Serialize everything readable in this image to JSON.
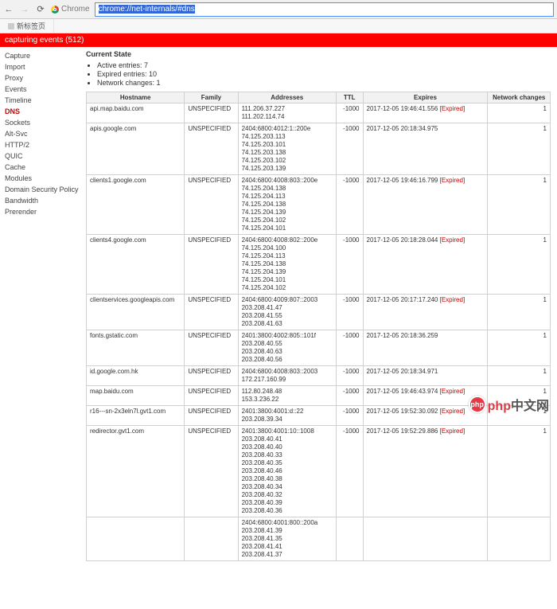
{
  "browser": {
    "back": "←",
    "forward": "→",
    "reload": "⟳",
    "label": "Chrome",
    "url": "chrome://net-internals/#dns"
  },
  "tab": {
    "title": "新标签页"
  },
  "banner": "capturing events (512)",
  "sidebar": [
    "Capture",
    "Import",
    "Proxy",
    "Events",
    "Timeline",
    "DNS",
    "Sockets",
    "Alt-Svc",
    "HTTP/2",
    "QUIC",
    "Cache",
    "Modules",
    "Domain Security Policy",
    "Bandwidth",
    "Prerender"
  ],
  "activeTab": "DNS",
  "section": "Current State",
  "stats": [
    "Active entries: 7",
    "Expired entries: 10",
    "Network changes: 1"
  ],
  "headers": {
    "host": "Hostname",
    "family": "Family",
    "addr": "Addresses",
    "ttl": "TTL",
    "exp": "Expires",
    "nc": "Network changes"
  },
  "expiredLabel": "[Expired]",
  "rows": [
    {
      "host": "api.map.baidu.com",
      "family": "UNSPECIFIED",
      "addr": [
        "111.206.37.227",
        "111.202.114.74"
      ],
      "ttl": "-1000",
      "exp": "2017-12-05 19:46:41.556",
      "expired": true,
      "nc": "1"
    },
    {
      "host": "apis.google.com",
      "family": "UNSPECIFIED",
      "addr": [
        "2404:6800:4012:1::200e",
        "74.125.203.113",
        "74.125.203.101",
        "74.125.203.138",
        "74.125.203.102",
        "74.125.203.139"
      ],
      "ttl": "-1000",
      "exp": "2017-12-05 20:18:34.975",
      "expired": false,
      "nc": "1"
    },
    {
      "host": "clients1.google.com",
      "family": "UNSPECIFIED",
      "addr": [
        "2404:6800:4008:803::200e",
        "74.125.204.138",
        "74.125.204.113",
        "74.125.204.138",
        "74.125.204.139",
        "74.125.204.102",
        "74.125.204.101"
      ],
      "ttl": "-1000",
      "exp": "2017-12-05 19:46:16.799",
      "expired": true,
      "nc": "1"
    },
    {
      "host": "clients4.google.com",
      "family": "UNSPECIFIED",
      "addr": [
        "2404:6800:4008:802::200e",
        "74.125.204.100",
        "74.125.204.113",
        "74.125.204.138",
        "74.125.204.139",
        "74.125.204.101",
        "74.125.204.102"
      ],
      "ttl": "-1000",
      "exp": "2017-12-05 20:18:28.044",
      "expired": true,
      "nc": "1"
    },
    {
      "host": "clientservices.googleapis.com",
      "family": "UNSPECIFIED",
      "addr": [
        "2404:6800:4009:807::2003",
        "203.208.41.47",
        "203.208.41.55",
        "203.208.41.63"
      ],
      "ttl": "-1000",
      "exp": "2017-12-05 20:17:17.240",
      "expired": true,
      "nc": "1"
    },
    {
      "host": "fonts.gstatic.com",
      "family": "UNSPECIFIED",
      "addr": [
        "2401:3800:4002:805::101f",
        "203.208.40.55",
        "203.208.40.63",
        "203.208.40.56"
      ],
      "ttl": "-1000",
      "exp": "2017-12-05 20:18:36.259",
      "expired": false,
      "nc": "1"
    },
    {
      "host": "id.google.com.hk",
      "family": "UNSPECIFIED",
      "addr": [
        "2404:6800:4008:803::2003",
        "172.217.160.99"
      ],
      "ttl": "-1000",
      "exp": "2017-12-05 20:18:34.971",
      "expired": false,
      "nc": "1"
    },
    {
      "host": "map.baidu.com",
      "family": "UNSPECIFIED",
      "addr": [
        "112.80.248.48",
        "153.3.236.22"
      ],
      "ttl": "-1000",
      "exp": "2017-12-05 19:46:43.974",
      "expired": true,
      "nc": "1"
    },
    {
      "host": "r16---sn-2x3eln7l.gvt1.com",
      "family": "UNSPECIFIED",
      "addr": [
        "2401:3800:4001:d::22",
        "203.208.39.34"
      ],
      "ttl": "-1000",
      "exp": "2017-12-05 19:52:30.092",
      "expired": true,
      "nc": "1"
    },
    {
      "host": "redirector.gvt1.com",
      "family": "UNSPECIFIED",
      "addr": [
        "2401:3800:4001:10::1008",
        "203.208.40.41",
        "203.208.40.40",
        "203.208.40.33",
        "203.208.40.35",
        "203.208.40.46",
        "203.208.40.38",
        "203.208.40.34",
        "203.208.40.32",
        "203.208.40.39",
        "203.208.40.36"
      ],
      "ttl": "-1000",
      "exp": "2017-12-05 19:52:29.886",
      "expired": true,
      "nc": "1"
    },
    {
      "host": "",
      "family": "",
      "addr": [
        "2404:6800:4001:800::200a",
        "203.208.41.39",
        "203.208.41.35",
        "203.208.41.41",
        "203.208.41.37"
      ],
      "ttl": "",
      "exp": "",
      "expired": false,
      "nc": ""
    }
  ],
  "watermark": {
    "logo": "php",
    "t1": "php",
    "t2": "中文网"
  }
}
